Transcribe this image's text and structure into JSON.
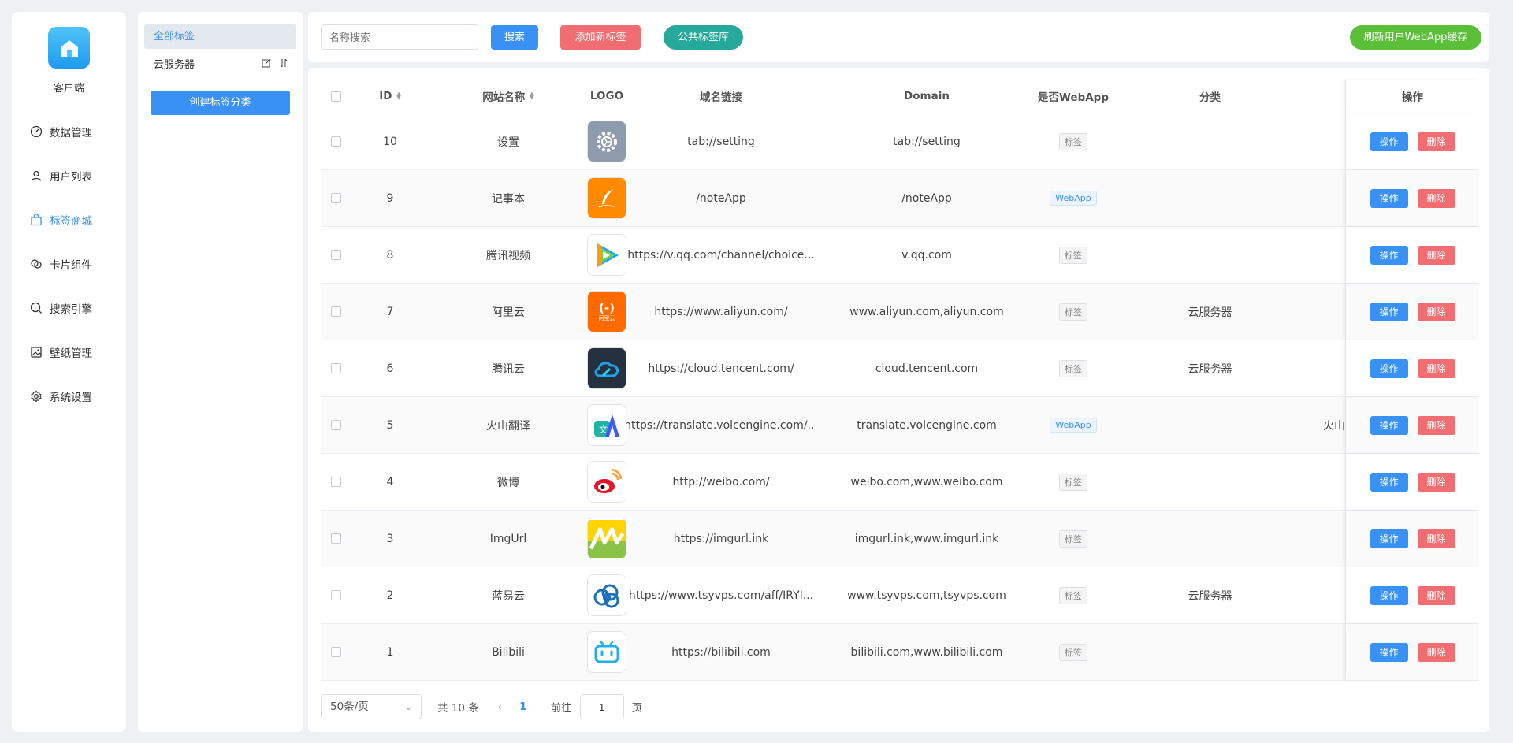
{
  "app": {
    "name": "客户端"
  },
  "sidebar": {
    "items": [
      {
        "label": "数据管理",
        "icon": "dashboard-icon"
      },
      {
        "label": "用户列表",
        "icon": "user-icon"
      },
      {
        "label": "标签商城",
        "icon": "shop-bag-icon",
        "active": true
      },
      {
        "label": "卡片组件",
        "icon": "cards-icon"
      },
      {
        "label": "搜索引擎",
        "icon": "search-icon"
      },
      {
        "label": "壁纸管理",
        "icon": "image-icon"
      },
      {
        "label": "系统设置",
        "icon": "gear-icon"
      }
    ]
  },
  "categories": {
    "all_label": "全部标签",
    "items": [
      {
        "label": "云服务器"
      }
    ],
    "create_label": "创建标签分类"
  },
  "toolbar": {
    "search_placeholder": "名称搜索",
    "search_label": "搜索",
    "add_label": "添加新标签",
    "library_label": "公共标签库",
    "refresh_label": "刷新用户WebApp缓存"
  },
  "table": {
    "headers": {
      "id": "ID",
      "name": "网站名称",
      "logo": "LOGO",
      "url": "域名链接",
      "domain": "Domain",
      "webapp": "是否WebApp",
      "category": "分类",
      "ops": "操作"
    },
    "rows": [
      {
        "id": "10",
        "name": "设置",
        "logo": "settings-logo",
        "url": "tab://setting",
        "domain": "tab://setting",
        "type": "标签",
        "webapp": false,
        "category": ""
      },
      {
        "id": "9",
        "name": "记事本",
        "logo": "notepad-logo",
        "url": "/noteApp",
        "domain": "/noteApp",
        "type": "WebApp",
        "webapp": true,
        "category": ""
      },
      {
        "id": "8",
        "name": "腾讯视频",
        "logo": "tencent-video-logo",
        "url": "https://v.qq.com/channel/choice...",
        "domain": "v.qq.com",
        "type": "标签",
        "webapp": false,
        "category": ""
      },
      {
        "id": "7",
        "name": "阿里云",
        "logo": "aliyun-logo",
        "url": "https://www.aliyun.com/",
        "domain": "www.aliyun.com,aliyun.com",
        "type": "标签",
        "webapp": false,
        "category": "云服务器"
      },
      {
        "id": "6",
        "name": "腾讯云",
        "logo": "tencent-cloud-logo",
        "url": "https://cloud.tencent.com/",
        "domain": "cloud.tencent.com",
        "type": "标签",
        "webapp": false,
        "category": "云服务器"
      },
      {
        "id": "5",
        "name": "火山翻译",
        "logo": "volc-translate-logo",
        "url": "https://translate.volcengine.com/...",
        "domain": "translate.volcengine.com",
        "type": "WebApp",
        "webapp": true,
        "category": "",
        "overflow": "火山"
      },
      {
        "id": "4",
        "name": "微博",
        "logo": "weibo-logo",
        "url": "http://weibo.com/",
        "domain": "weibo.com,www.weibo.com",
        "type": "标签",
        "webapp": false,
        "category": ""
      },
      {
        "id": "3",
        "name": "ImgUrl",
        "logo": "imgurl-logo",
        "url": "https://imgurl.ink",
        "domain": "imgurl.ink,www.imgurl.ink",
        "type": "标签",
        "webapp": false,
        "category": ""
      },
      {
        "id": "2",
        "name": "蓝易云",
        "logo": "tsyvps-logo",
        "url": "https://www.tsyvps.com/aff/IRYI...",
        "domain": "www.tsyvps.com,tsyvps.com",
        "type": "标签",
        "webapp": false,
        "category": "云服务器"
      },
      {
        "id": "1",
        "name": "Bilibili",
        "logo": "bilibili-logo",
        "url": "https://bilibili.com",
        "domain": "bilibili.com,www.bilibili.com",
        "type": "标签",
        "webapp": false,
        "category": ""
      }
    ],
    "op_edit_label": "操作",
    "op_delete_label": "删除"
  },
  "pagination": {
    "page_size": "50条/页",
    "total": "共 10 条",
    "current": "1",
    "goto_label": "前往",
    "goto_value": "1",
    "page_label": "页"
  },
  "colors": {
    "primary": "#3a91f4",
    "danger": "#f06e72",
    "teal": "#26a99a",
    "success": "#5cbf3a"
  }
}
